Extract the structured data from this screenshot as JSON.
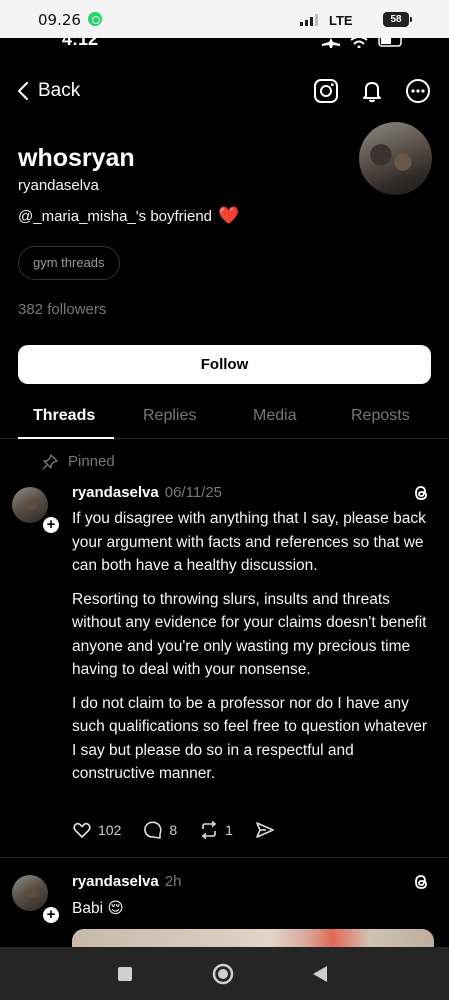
{
  "device_status": {
    "time": "09.26",
    "network": "LTE",
    "battery": "58"
  },
  "inner_status": {
    "time": "4:12"
  },
  "nav": {
    "back_label": "Back",
    "icons": [
      "instagram-icon",
      "bell-icon",
      "more-options-icon"
    ]
  },
  "profile": {
    "name": "whosryan",
    "username": "ryandaselva",
    "bio_mention": "@_maria_misha_",
    "bio_text": "'s boyfriend",
    "bio_emoji": "❤️",
    "tag": "gym threads",
    "followers": "382 followers",
    "follow_label": "Follow"
  },
  "tabs": [
    {
      "label": "Threads",
      "active": true
    },
    {
      "label": "Replies",
      "active": false
    },
    {
      "label": "Media",
      "active": false
    },
    {
      "label": "Reposts",
      "active": false
    }
  ],
  "posts": [
    {
      "pinned_label": "Pinned",
      "username": "ryandaselva",
      "date": "06/11/25",
      "paragraphs": [
        "If you disagree with anything that I say, please back your argument with facts and references so that we can both have a healthy discussion.",
        "Resorting to throwing slurs, insults and threats without any evidence for your claims doesn't benefit anyone and you're only wasting my precious time having to deal with your nonsense.",
        "I do not claim to be a professor nor do I have any such qualifications so feel free to question whatever I say but please do so in a respectful and constructive manner."
      ],
      "likes": "102",
      "comments": "8",
      "reposts": "1"
    },
    {
      "username": "ryandaselva",
      "date": "2h",
      "text": "Babi",
      "emoji": "😌"
    }
  ],
  "colors": {
    "background": "#000000",
    "text": "#f3f5f7",
    "muted": "#777777",
    "heart": "#e0245e"
  }
}
